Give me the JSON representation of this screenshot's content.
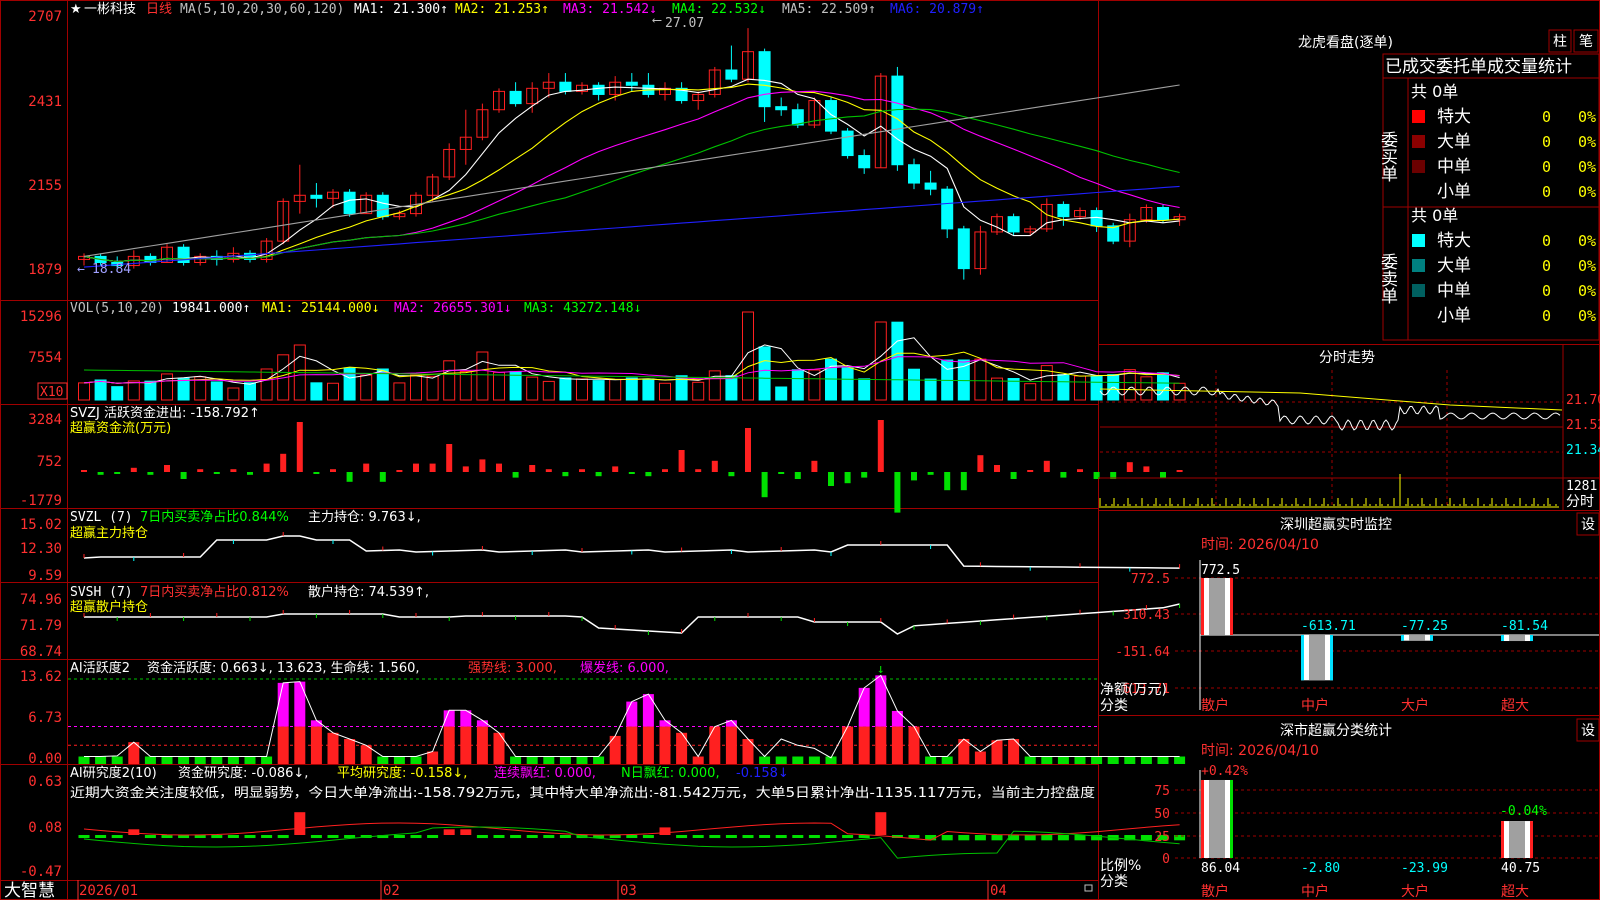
{
  "stock": {
    "name": "一彬科技",
    "star": "★",
    "period": "日线",
    "brand": "大智慧"
  },
  "colors": {
    "bg": "#000000",
    "frame": "#a00000",
    "up": "#ff2020",
    "down": "#00ffff",
    "axis_text": "#ff3030",
    "white": "#ffffff",
    "yellow": "#ffff00",
    "magenta": "#ff00ff",
    "green": "#00c000",
    "gray": "#a0a0a0",
    "blue": "#2020ff",
    "cyan": "#00ffff"
  },
  "kline": {
    "title": {
      "ma": "MA(5,10,20,30,60,120)",
      "ma1": "MA1: 21.300↑",
      "ma2": "MA2: 21.253↑",
      "ma3": "MA3: 21.542↓",
      "ma4": "MA4: 22.532↓",
      "ma5": "MA5: 22.509↑",
      "ma6": "MA6: 20.879↑"
    },
    "y_ticks": [
      "2707",
      "2431",
      "2155",
      "1879"
    ],
    "high_label": "27.07",
    "low_label": "18.84",
    "ylim": [
      18.5,
      27.5
    ]
  },
  "vol": {
    "title": {
      "name": "VOL(5,10,20)",
      "val": "19841.000↑",
      "ma1": "MA1: 25144.000↓",
      "ma2": "MA2: 26655.301↓",
      "ma3": "MA3: 43272.148↓"
    },
    "y_ticks": [
      "15296",
      "7554"
    ],
    "unit": "X10"
  },
  "svzj": {
    "title": "SVZJ  活跃资金进出: -158.792↑",
    "sub": "超赢资金流(万元)",
    "y_ticks": [
      "3284",
      "752",
      "-1779"
    ]
  },
  "svzl": {
    "title_a": "SVZL (7)",
    "title_b": "7日内买卖净占比0.844%",
    "title_c": "主力持仓: 9.763↓,",
    "sub": "超赢主力持仓",
    "y_ticks": [
      "15.02",
      "12.30",
      "9.59"
    ]
  },
  "svsh": {
    "title_a": "SVSH (7)",
    "title_b": "7日内买卖净占比0.812%",
    "title_c": "散户持仓: 74.539↑,",
    "sub": "超赢散户持仓",
    "y_ticks": [
      "74.96",
      "71.79",
      "68.74"
    ]
  },
  "ai1": {
    "title_a": "AI活跃度2",
    "title_b": "资金活跃度: 0.663↓, 13.623, 生命线: 1.560,",
    "title_c": "强势线: 3.000,",
    "title_d": "爆发线: 6.000,",
    "y_ticks": [
      "13.62",
      "6.73",
      "0.00"
    ]
  },
  "ai2": {
    "title_a": "AI研究度2(10)",
    "title_b": "资金研究度: -0.086↓,",
    "title_c": "平均研究度: -0.158↓,",
    "title_d": "连续飘红: 0.000,",
    "title_e": "N日飘红: 0.000,",
    "title_f": "-0.158↓",
    "comment": "近期大资金关注度较低，明显弱势，今日大单净流出:-158.792万元，其中特大单净流出:-81.542万元，大单5日累计净出-1135.117万元，当前主力控盘度",
    "y_ticks": [
      "0.63",
      "0.08",
      "-0.47"
    ]
  },
  "x_axis": [
    "2026/01",
    "02",
    "03",
    "04"
  ],
  "right": {
    "lhb_title": "龙虎看盘(逐单)",
    "tab1": "柱",
    "tab2": "笔",
    "deal_title": "已成交委托单成交量统计",
    "buy_label": "委买单",
    "sell_label": "委卖单",
    "buy_total": "共 0单",
    "sell_total": "共 0单",
    "buy_rows": [
      {
        "name": "特大",
        "num": "0",
        "pct": "0%"
      },
      {
        "name": "大单",
        "num": "0",
        "pct": "0%"
      },
      {
        "name": "中单",
        "num": "0",
        "pct": "0%"
      },
      {
        "name": "小单",
        "num": "0",
        "pct": "0%"
      }
    ],
    "sell_rows": [
      {
        "name": "特大",
        "num": "0",
        "pct": "0%"
      },
      {
        "name": "大单",
        "num": "0",
        "pct": "0%"
      },
      {
        "name": "中单",
        "num": "0",
        "pct": "0%"
      },
      {
        "name": "小单",
        "num": "0",
        "pct": "0%"
      }
    ],
    "fs_title": "分时走势",
    "fs_ticks": [
      "21.70",
      "21.52",
      "21.34"
    ],
    "fs_vol": "1281",
    "fs_vol_unit": "分时",
    "sz_title": "深圳超赢实时监控",
    "sz_btn": "设",
    "sz_time": "时间: 2026/04/10",
    "sz_ticks": [
      "772.5",
      "310.43",
      "-151.64",
      "-613.71"
    ],
    "sz_axis": "净额(万元)",
    "sz_cat_label": "分类",
    "sz_values": [
      "772.5",
      "-613.71",
      "-77.25",
      "-81.54"
    ],
    "sz_cats": [
      "散户",
      "中户",
      "大户",
      "超大"
    ],
    "fl_title": "深市超赢分类统计",
    "fl_btn": "设",
    "fl_time": "时间: 2026/04/10",
    "fl_ticks": [
      "75",
      "50",
      "25",
      "0"
    ],
    "fl_axis": "比例%",
    "fl_cat_label": "分类",
    "fl_top": [
      "+0.42%",
      "-0.04%"
    ],
    "fl_values": [
      "86.04",
      "-2.80",
      "-23.99",
      "40.75"
    ],
    "fl_cats": [
      "散户",
      "中户",
      "大户",
      "超大"
    ]
  },
  "chart_data": [
    {
      "type": "candlestick",
      "x": [
        "2026/01",
        "02",
        "03",
        "04"
      ],
      "ylim": [
        18.5,
        27.5
      ],
      "ohlc": [
        [
          19.5,
          19.7,
          19.3,
          19.6
        ],
        [
          19.6,
          19.7,
          19.3,
          19.4
        ],
        [
          19.4,
          19.6,
          19.2,
          19.3
        ],
        [
          19.3,
          19.8,
          19.2,
          19.6
        ],
        [
          19.6,
          19.7,
          19.3,
          19.4
        ],
        [
          19.4,
          20.0,
          19.4,
          19.9
        ],
        [
          19.9,
          20.0,
          19.3,
          19.4
        ],
        [
          19.4,
          19.7,
          19.3,
          19.6
        ],
        [
          19.6,
          19.8,
          19.3,
          19.5
        ],
        [
          19.5,
          19.9,
          19.4,
          19.7
        ],
        [
          19.7,
          19.8,
          19.4,
          19.5
        ],
        [
          19.5,
          20.2,
          19.4,
          20.1
        ],
        [
          20.1,
          21.5,
          20.0,
          21.4
        ],
        [
          21.4,
          22.6,
          21.0,
          21.6
        ],
        [
          21.6,
          22.0,
          21.2,
          21.5
        ],
        [
          21.5,
          21.8,
          21.2,
          21.7
        ],
        [
          21.7,
          21.8,
          20.9,
          21.0
        ],
        [
          21.0,
          21.7,
          21.0,
          21.6
        ],
        [
          21.6,
          21.7,
          20.8,
          20.9
        ],
        [
          20.9,
          21.1,
          20.8,
          21.0
        ],
        [
          21.0,
          21.7,
          20.9,
          21.6
        ],
        [
          21.6,
          22.3,
          21.4,
          22.2
        ],
        [
          22.2,
          23.3,
          22.1,
          23.1
        ],
        [
          23.1,
          24.4,
          22.6,
          23.5
        ],
        [
          23.5,
          24.6,
          23.4,
          24.4
        ],
        [
          24.4,
          25.1,
          24.3,
          25.0
        ],
        [
          25.0,
          25.3,
          24.5,
          24.6
        ],
        [
          24.6,
          25.3,
          24.3,
          25.1
        ],
        [
          25.1,
          25.6,
          24.8,
          25.3
        ],
        [
          25.3,
          25.6,
          24.9,
          25.0
        ],
        [
          25.0,
          25.3,
          24.9,
          25.2
        ],
        [
          25.2,
          25.3,
          24.7,
          24.9
        ],
        [
          24.9,
          25.5,
          24.7,
          25.3
        ],
        [
          25.3,
          25.6,
          25.0,
          25.2
        ],
        [
          25.2,
          25.6,
          24.8,
          24.9
        ],
        [
          24.9,
          25.3,
          24.7,
          25.1
        ],
        [
          25.1,
          25.3,
          24.6,
          24.7
        ],
        [
          24.7,
          25.0,
          24.4,
          24.9
        ],
        [
          24.9,
          25.8,
          24.8,
          25.7
        ],
        [
          25.7,
          26.5,
          25.3,
          25.4
        ],
        [
          25.4,
          27.07,
          25.3,
          26.3
        ],
        [
          26.3,
          26.4,
          24.0,
          24.5
        ],
        [
          24.5,
          24.8,
          24.2,
          24.4
        ],
        [
          24.4,
          24.6,
          23.8,
          23.9
        ],
        [
          23.9,
          24.8,
          23.8,
          24.7
        ],
        [
          24.7,
          24.8,
          23.6,
          23.7
        ],
        [
          23.7,
          23.8,
          22.8,
          22.9
        ],
        [
          22.9,
          23.1,
          22.3,
          22.5
        ],
        [
          22.5,
          25.6,
          22.5,
          25.5
        ],
        [
          25.5,
          25.8,
          22.4,
          22.6
        ],
        [
          22.6,
          22.8,
          21.8,
          22.0
        ],
        [
          22.0,
          22.4,
          21.6,
          21.8
        ],
        [
          21.8,
          21.9,
          20.2,
          20.5
        ],
        [
          20.5,
          20.6,
          18.84,
          19.2
        ],
        [
          19.2,
          20.6,
          19.0,
          20.4
        ],
        [
          20.4,
          21.0,
          20.3,
          20.9
        ],
        [
          20.9,
          21.0,
          20.3,
          20.4
        ],
        [
          20.4,
          20.6,
          20.3,
          20.5
        ],
        [
          20.5,
          21.5,
          20.4,
          21.3
        ],
        [
          21.3,
          21.4,
          20.6,
          20.9
        ],
        [
          20.9,
          21.2,
          20.8,
          21.1
        ],
        [
          21.1,
          21.2,
          20.4,
          20.6
        ],
        [
          20.6,
          20.7,
          20.0,
          20.1
        ],
        [
          20.1,
          21.0,
          19.9,
          20.8
        ],
        [
          20.8,
          21.3,
          20.7,
          21.2
        ],
        [
          21.2,
          21.3,
          20.7,
          20.8
        ],
        [
          20.8,
          21.0,
          20.6,
          20.9
        ]
      ]
    }
  ]
}
